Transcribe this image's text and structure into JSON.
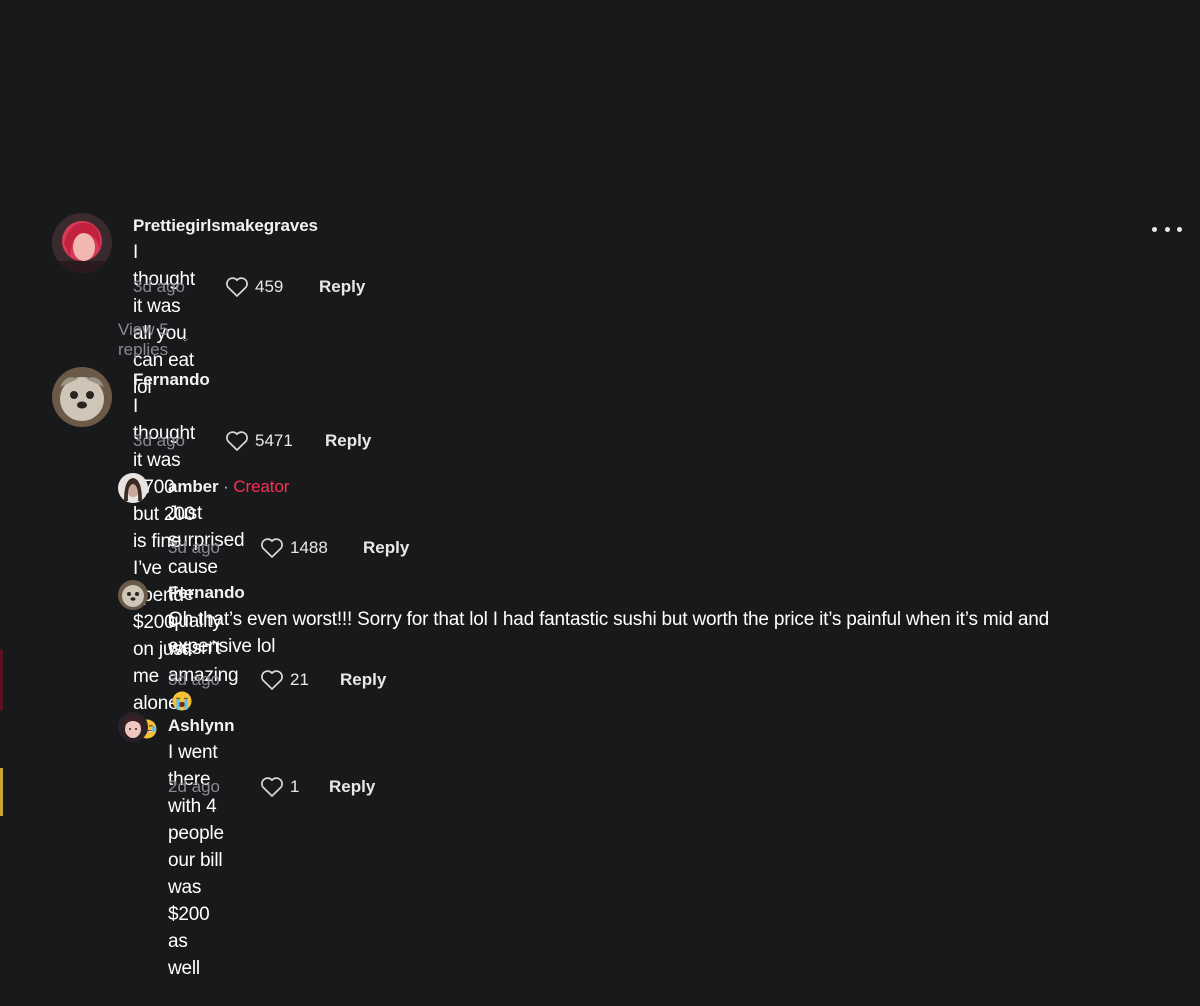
{
  "comments": [
    {
      "username": "Prettiegirlsmakegraves",
      "text": "I thought it was all you can eat lol",
      "time": "3d ago",
      "likes": "459",
      "reply_label": "Reply",
      "view_replies": "View 5 replies"
    },
    {
      "username": "Fernando",
      "text": "I thought it was $700 but 200 is fine I’ve spend $200 on just me alone",
      "emoji": "face-with-tears-of-joy",
      "time": "3d ago",
      "likes": "5471",
      "reply_label": "Reply",
      "replies": [
        {
          "username": "amber",
          "separator": "·",
          "badge": "Creator",
          "text": "Just surprised cause the quality wasn’t amazing",
          "emoji": "loudly-crying-face",
          "time": "3d ago",
          "likes": "1488",
          "reply_label": "Reply"
        },
        {
          "username": "Fernando",
          "text": "Oh that’s even worst!!! Sorry for that lol I had fantastic sushi but worth the price it’s painful when it’s mid and expensive lol",
          "time": "3d ago",
          "likes": "21",
          "reply_label": "Reply"
        },
        {
          "username": "Ashlynn",
          "text": "I went there with 4 people our bill was $200 as well",
          "time": "2d ago",
          "likes": "1",
          "reply_label": "Reply"
        }
      ]
    }
  ],
  "icons": {
    "more": "more-horizontal-icon",
    "like": "heart-outline-icon",
    "expand": "chevron-down-icon"
  },
  "colors": {
    "background": "#18191b",
    "creator_badge": "#fe2c55",
    "muted_text": "#8a8b91"
  }
}
